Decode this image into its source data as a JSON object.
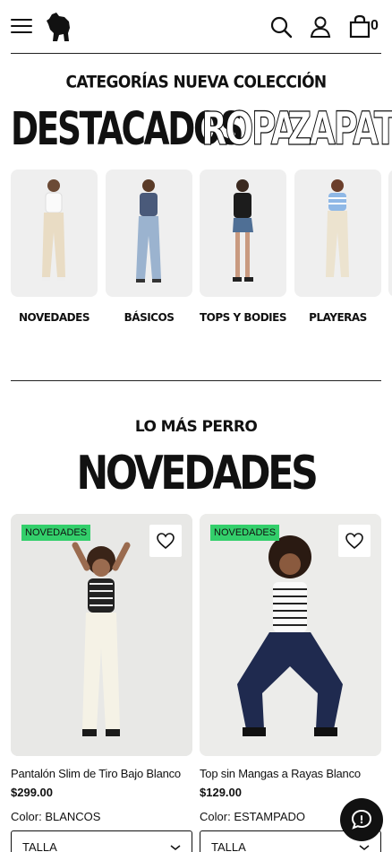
{
  "header": {
    "cart_count": "0",
    "icons": [
      "menu-icon",
      "logo",
      "search-icon",
      "account-icon",
      "bag-icon"
    ]
  },
  "categories_section": {
    "title": "CATEGORÍAS NUEVA COLECCIÓN",
    "tabs": [
      "DESTACADOS",
      "ROPA",
      "ZAPATOS"
    ],
    "active_tab": "DESTACADOS",
    "items": [
      {
        "label": "NOVEDADES"
      },
      {
        "label": "BÁSICOS"
      },
      {
        "label": "TOPS Y BODIES"
      },
      {
        "label": "PLAYERAS"
      }
    ]
  },
  "featured": {
    "kicker": "LO MÁS PERRO",
    "title": "NOVEDADES"
  },
  "products": [
    {
      "badge": "NOVEDADES",
      "name": "Pantalón Slim de Tiro Bajo Blanco",
      "price": "$299.00",
      "color_label": "Color:",
      "color": "BLANCOS",
      "size_label": "TALLA"
    },
    {
      "badge": "NOVEDADES",
      "name": "Top sin Mangas a Rayas Blanco",
      "price": "$129.00",
      "color_label": "Color:",
      "color": "ESTAMPADO",
      "size_label": "TALLA"
    }
  ],
  "colors": {
    "badge_green": "#33cf6b",
    "text": "#111111",
    "card_bg": "#efefef"
  }
}
